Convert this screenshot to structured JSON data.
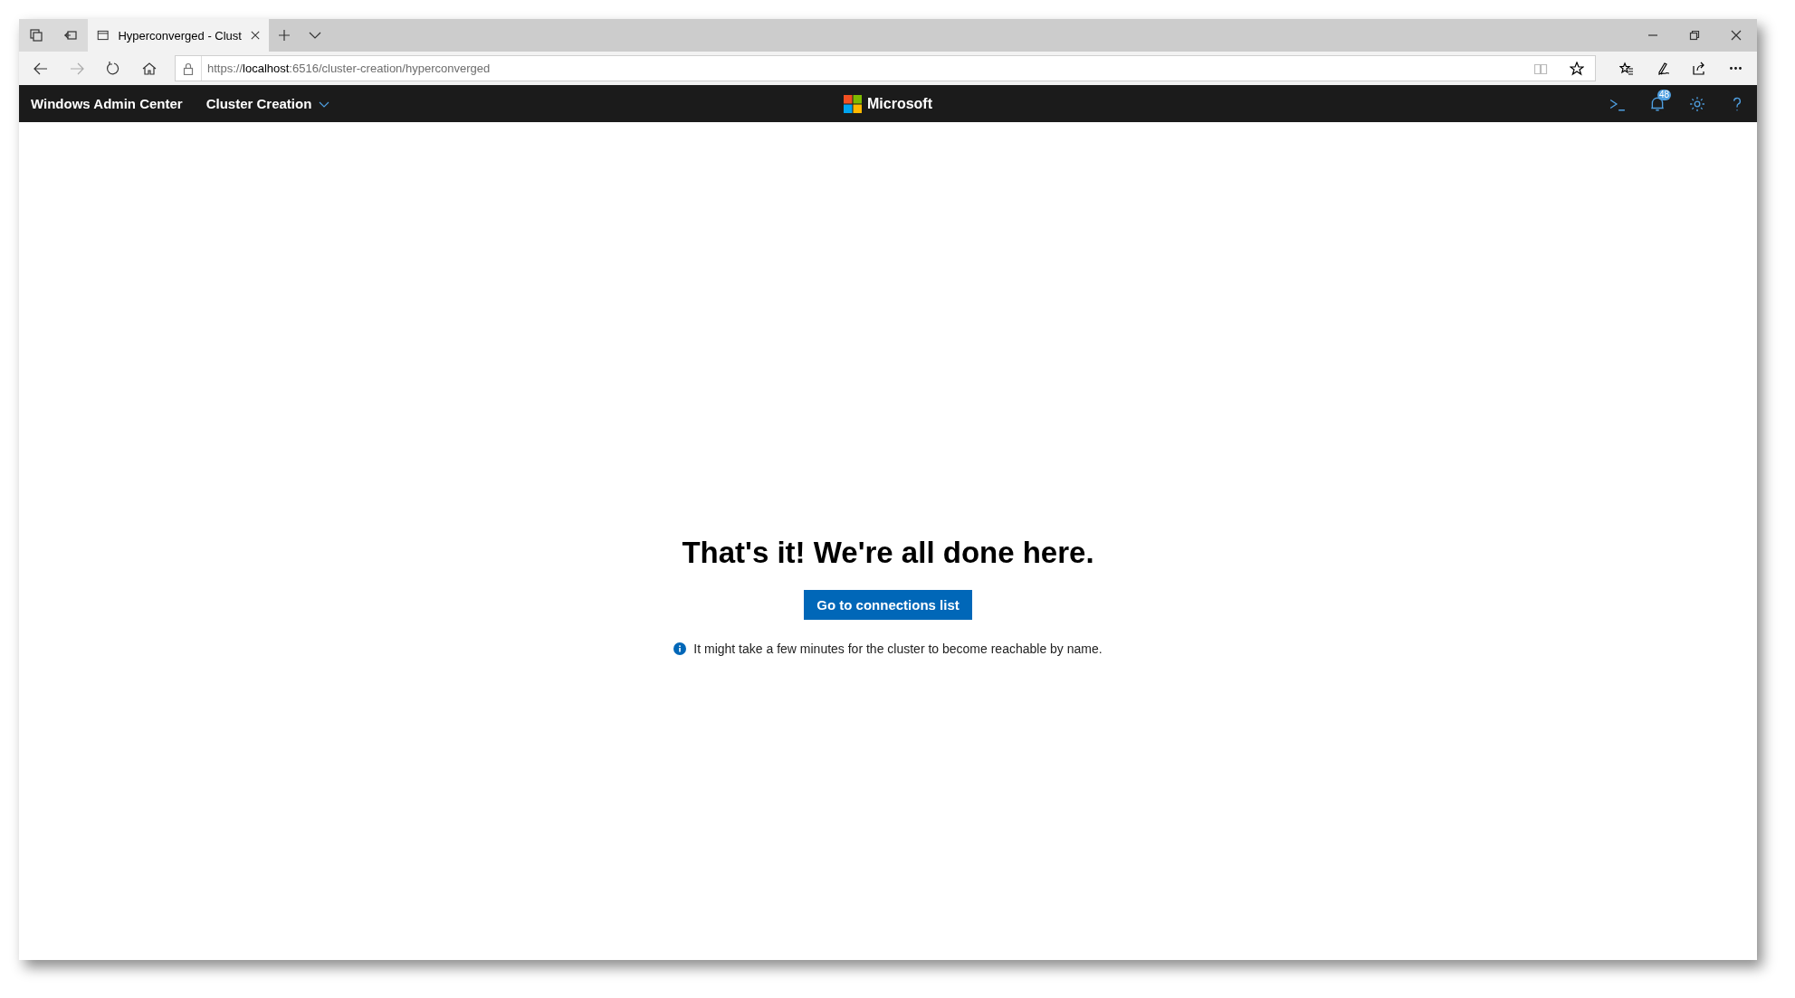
{
  "browser": {
    "tab": {
      "title": "Hyperconverged - Clust",
      "selected": true
    },
    "address": {
      "scheme": "https://",
      "host": "localhost",
      "path": ":6516/cluster-creation/hyperconverged"
    }
  },
  "app_header": {
    "title": "Windows Admin Center",
    "context_menu": "Cluster Creation",
    "brand": "Microsoft",
    "notification_count": "48"
  },
  "content": {
    "heading": "That's it! We're all done here.",
    "button": "Go to connections list",
    "info": "It might take a few minutes for the cluster to become reachable by name."
  }
}
